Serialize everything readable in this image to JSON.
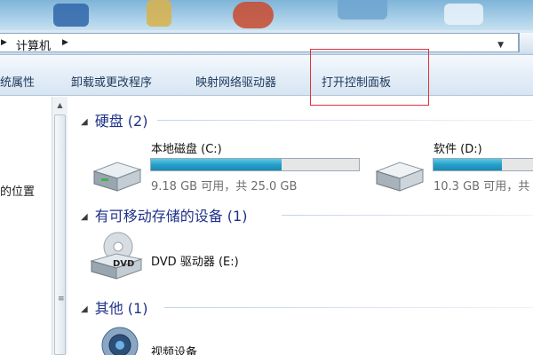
{
  "address": {
    "segments": [
      "计算机"
    ]
  },
  "commands": {
    "system_properties": "统属性",
    "uninstall": "卸载或更改程序",
    "map_drive": "映射网络驱动器",
    "control_panel": "打开控制面板"
  },
  "nav": {
    "location_text": "的位置"
  },
  "groups": {
    "hard_disks": {
      "title": "硬盘 (2)"
    },
    "removable": {
      "title": "有可移动存储的设备 (1)"
    },
    "other": {
      "title": "其他 (1)"
    }
  },
  "drives": {
    "c": {
      "name": "本地磁盘 (C:)",
      "size": "9.18 GB 可用，共 25.0 GB",
      "used_fraction": 0.63
    },
    "d": {
      "name": "软件 (D:)",
      "size": "10.3 GB 可用，共",
      "used_fraction": 0.65
    },
    "dvd": {
      "name": "DVD 驱动器 (E:)",
      "label": "DVD"
    },
    "video": {
      "name": "视频设备"
    }
  },
  "colors": {
    "group_header": "#1e3287",
    "highlight_box": "#e0323a",
    "usage_bar": "#26a0c9"
  },
  "icons": {
    "hard_drive": "hard-drive-icon",
    "dvd_drive": "dvd-drive-icon",
    "webcam": "webcam-icon"
  }
}
